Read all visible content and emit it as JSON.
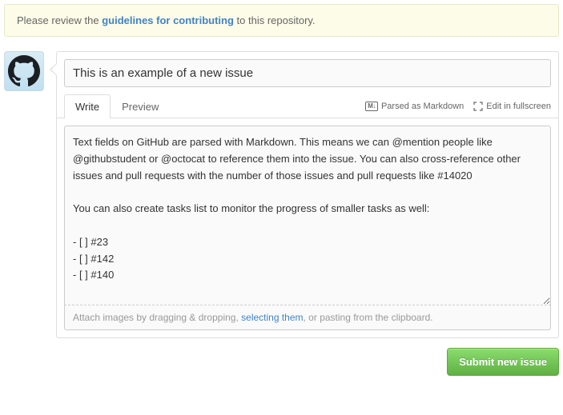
{
  "notice": {
    "prefix": "Please review the ",
    "link": "guidelines for contributing",
    "suffix": " to this repository."
  },
  "issue": {
    "title": "This is an example of a new issue",
    "body": "Text fields on GitHub are parsed with Markdown. This means we can @mention people like @githubstudent or @octocat to reference them into the issue. You can also cross-reference other issues and pull requests with the number of those issues and pull requests like #14020\n\nYou can also create tasks list to monitor the progress of smaller tasks as well:\n\n- [ ] #23\n- [ ] #142\n- [ ] #140"
  },
  "tabs": {
    "write": "Write",
    "preview": "Preview",
    "markdown_hint": "Parsed as Markdown",
    "fullscreen": "Edit in fullscreen"
  },
  "attach": {
    "prefix": "Attach images by dragging & dropping, ",
    "link": "selecting them",
    "suffix": ", or pasting from the clipboard."
  },
  "submit_label": "Submit new issue"
}
